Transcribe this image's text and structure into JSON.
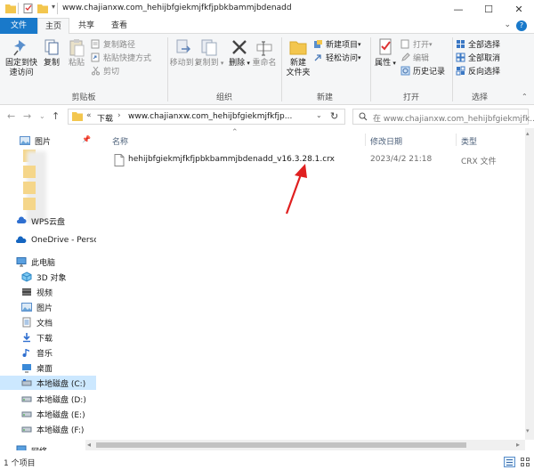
{
  "window": {
    "title": "www.chajianxw.com_hehijbfgiekmjfkfjpbkbammjbdenadd",
    "minimize": "—",
    "maximize": "☐",
    "close": "✕"
  },
  "ribbon_tabs": [
    "文件",
    "主页",
    "共享",
    "查看"
  ],
  "ribbon": {
    "clipboard": {
      "label": "剪贴板",
      "pin": "固定到快\n速访问",
      "copy": "复制",
      "paste": "粘贴",
      "copy_path": "复制路径",
      "paste_shortcut": "粘贴快捷方式",
      "cut": "剪切"
    },
    "organize": {
      "label": "组织",
      "move_to": "移动到",
      "copy_to": "复制到",
      "delete": "删除",
      "rename": "重命名"
    },
    "new": {
      "label": "新建",
      "new_folder": "新建\n文件夹",
      "new_item": "新建项目",
      "easy_access": "轻松访问"
    },
    "open": {
      "label": "打开",
      "properties": "属性",
      "open": "打开",
      "edit": "编辑",
      "history": "历史记录"
    },
    "select": {
      "label": "选择",
      "select_all": "全部选择",
      "select_none": "全部取消",
      "invert": "反向选择"
    }
  },
  "address": {
    "prefix": "«",
    "crumb1": "下载",
    "sep": "›",
    "crumb2": "www.chajianxw.com_hehijbfgiekmjfkfjp...",
    "search_placeholder": "在 www.chajianxw.com_hehijbfgiekmjfk..."
  },
  "sidebar": {
    "pictures_pinned": "图片",
    "wps": "WPS云盘",
    "onedrive": "OneDrive - Perso",
    "this_pc": "此电脑",
    "objects3d": "3D 对象",
    "videos": "视频",
    "pictures": "图片",
    "documents": "文档",
    "downloads": "下载",
    "music": "音乐",
    "desktop": "桌面",
    "drive_c": "本地磁盘 (C:)",
    "drive_d": "本地磁盘 (D:)",
    "drive_e": "本地磁盘 (E:)",
    "drive_f": "本地磁盘 (F:)",
    "network": "网络"
  },
  "columns": {
    "name": "名称",
    "modified": "修改日期",
    "type": "类型"
  },
  "files": [
    {
      "name": "hehijbfgiekmjfkfjpbkbammjbdenadd_v16.3.28.1.crx",
      "modified": "2023/4/2 21:18",
      "type": "CRX 文件"
    }
  ],
  "status": {
    "count": "1 个项目"
  },
  "colors": {
    "accent": "#1979ca",
    "arrow": "#e02020",
    "selected": "#cce8ff"
  }
}
